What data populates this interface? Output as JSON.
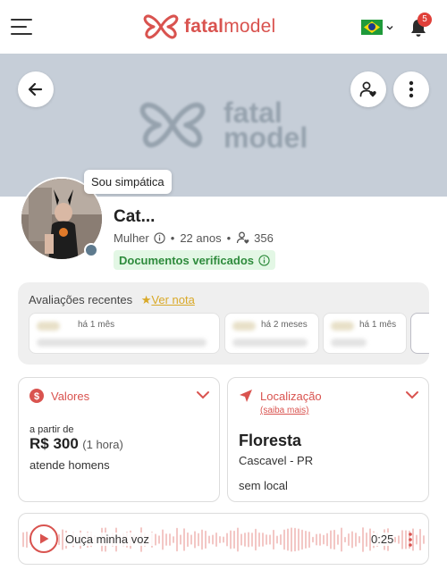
{
  "header": {
    "logo_text_bold": "fatal",
    "logo_text_light": "model",
    "notification_count": "5",
    "language": "pt-BR flag"
  },
  "cover": {
    "logo_line1": "fatal",
    "logo_line2": "model"
  },
  "profile": {
    "bubble": "Sou simpática",
    "name": "Cat...",
    "gender": "Mulher",
    "age": "22 anos",
    "followers": "356",
    "verified": "Documentos verificados",
    "status_color": "#5e7a8e"
  },
  "reviews": {
    "title": "Avaliações recentes",
    "link": "Ver nota",
    "items": [
      {
        "when": "há 1 mês"
      },
      {
        "when": "há 2 meses"
      },
      {
        "when": "há 1 mês"
      }
    ]
  },
  "prices": {
    "title": "Valores",
    "from_label": "a partir de",
    "price": "R$ 300",
    "unit": "(1 hora)",
    "serves": "atende homens"
  },
  "location": {
    "title": "Localização",
    "more": "(saiba mais)",
    "neighborhood": "Floresta",
    "city": "Cascavel - PR",
    "place": "sem local"
  },
  "audio": {
    "label": "Ouça minha voz",
    "duration": "0:25"
  },
  "colors": {
    "accent": "#d9534f",
    "gold": "#d9a928",
    "verified_bg": "#e3f7e5",
    "verified_text": "#2e8b3c"
  },
  "icons": [
    "menu-icon",
    "butterfly-logo-icon",
    "brazil-flag-icon",
    "bell-icon",
    "back-arrow-icon",
    "user-heart-icon",
    "more-vertical-icon",
    "info-icon",
    "followers-icon",
    "info-circle-icon",
    "dollar-icon",
    "location-arrow-icon",
    "chevron-down-icon",
    "play-icon"
  ]
}
